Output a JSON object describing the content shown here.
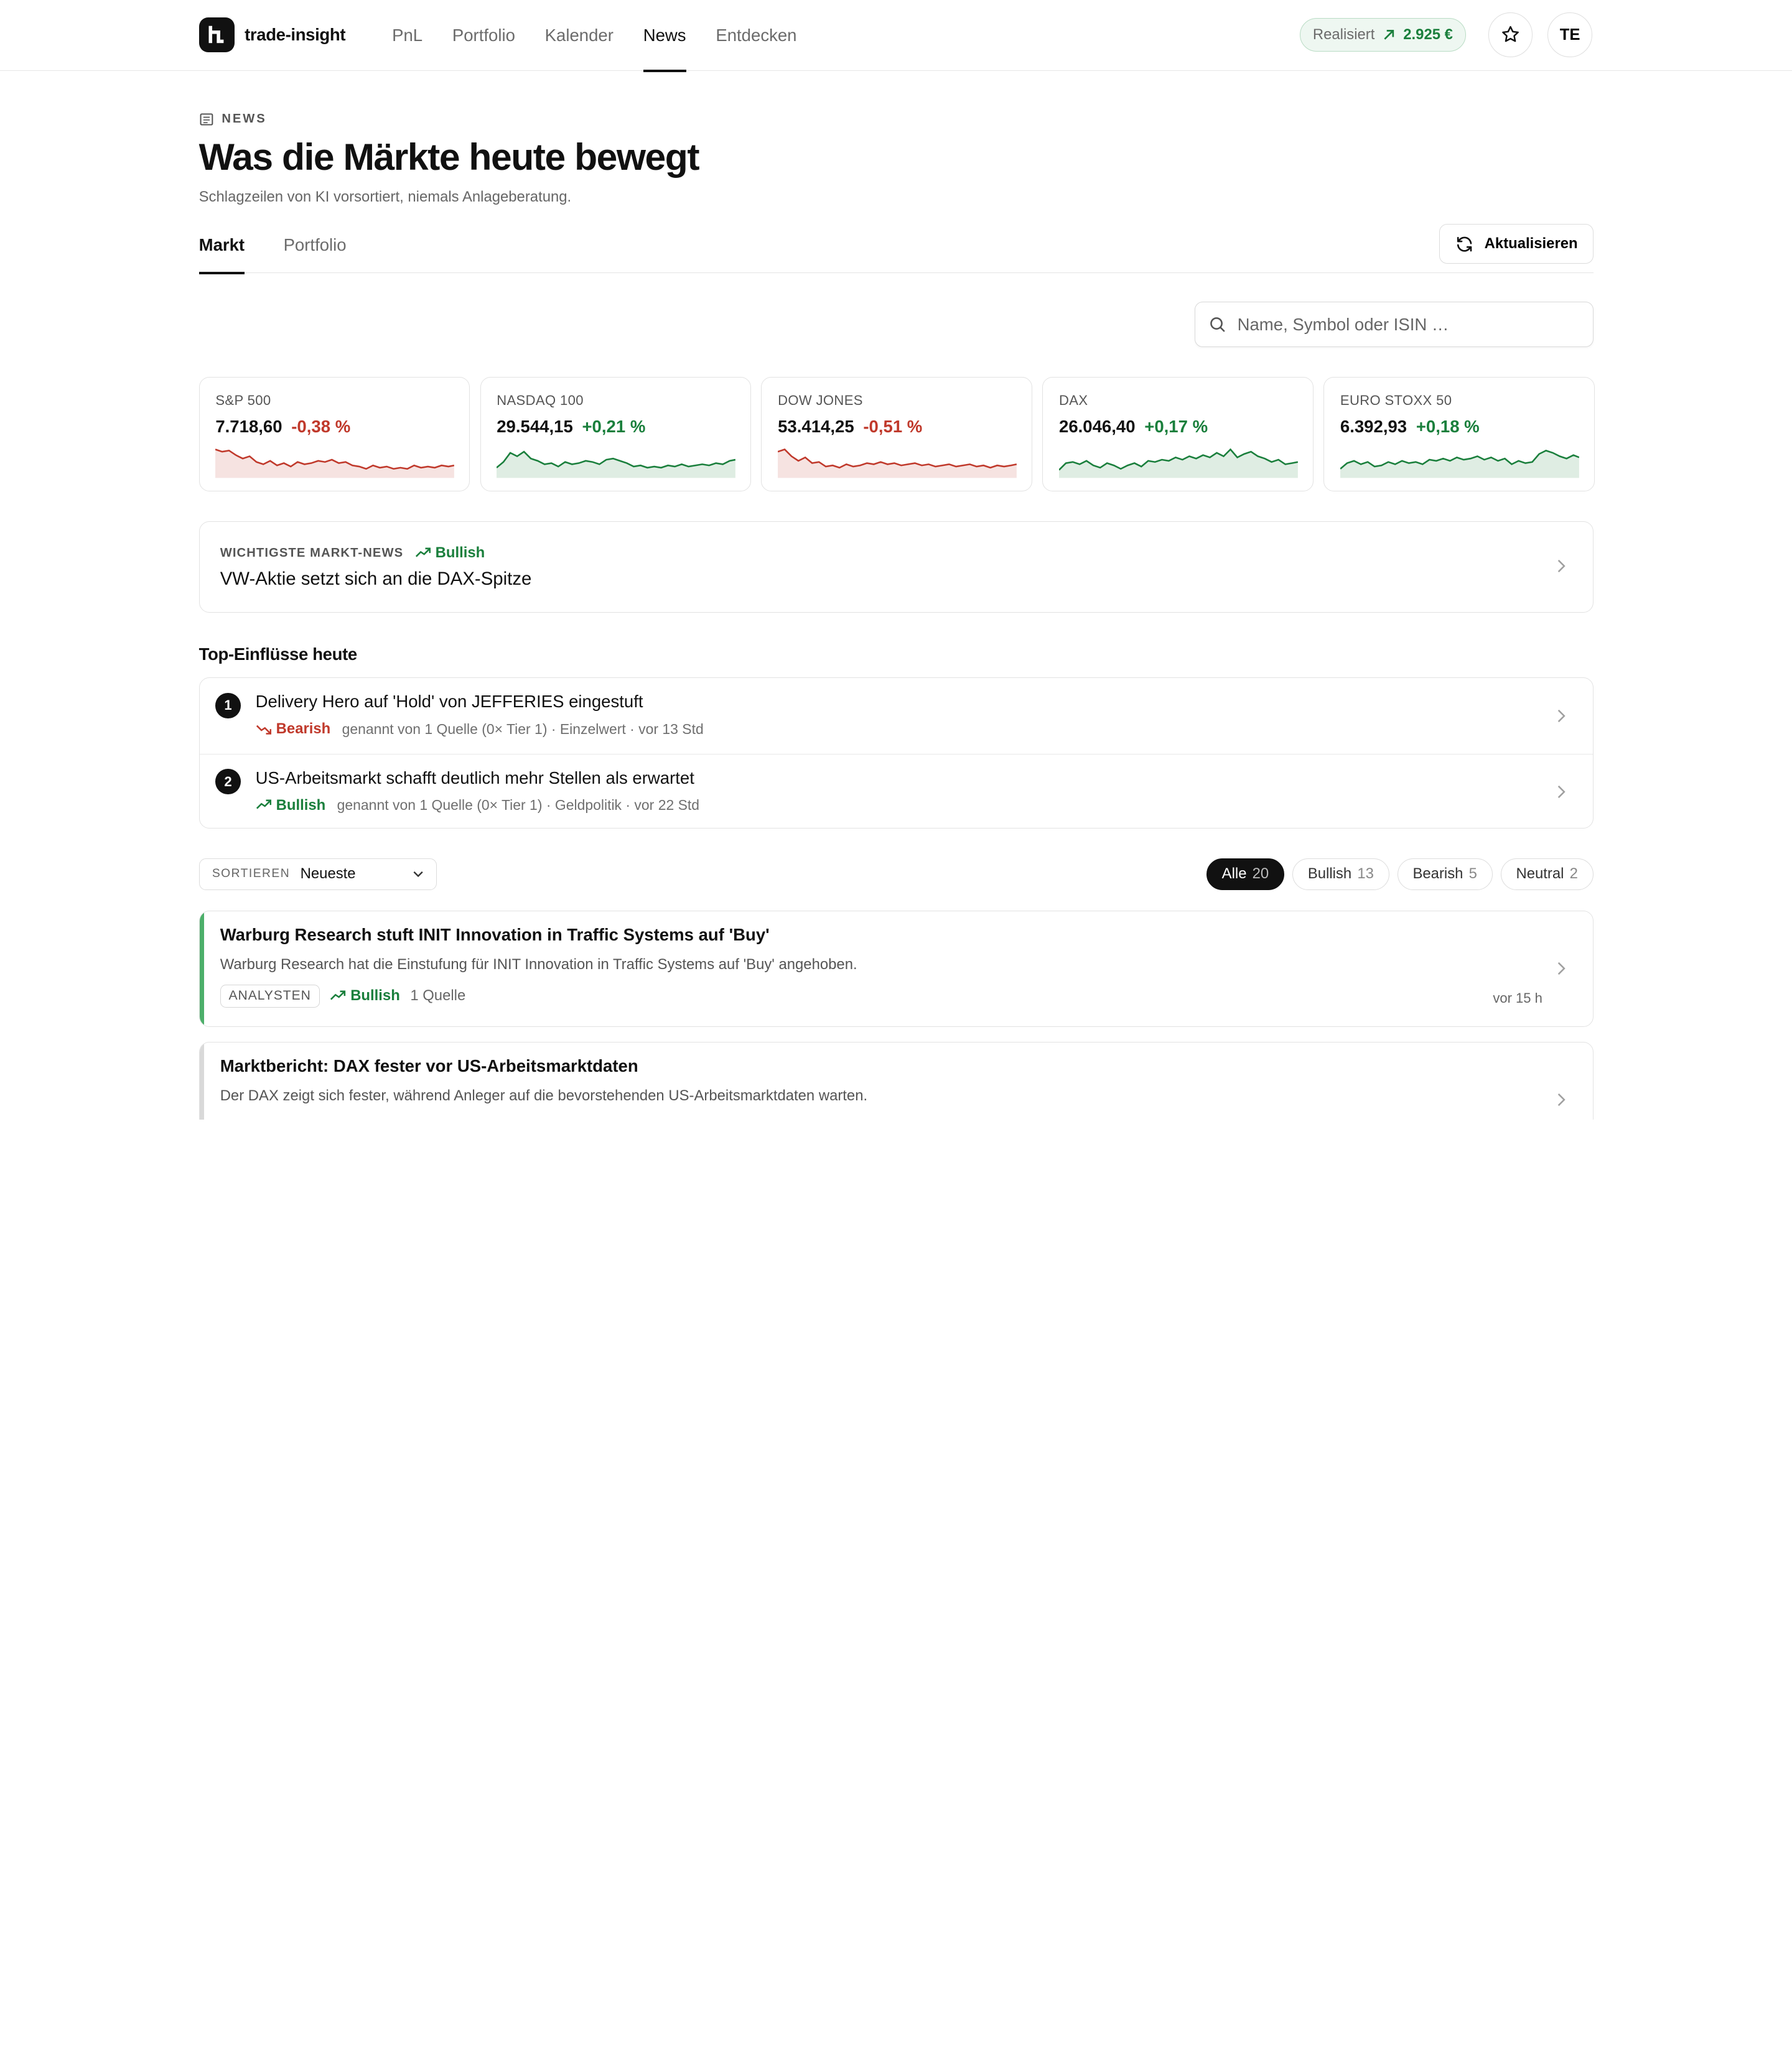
{
  "app": {
    "name": "trade-insight"
  },
  "nav": {
    "items": [
      {
        "label": "PnL"
      },
      {
        "label": "Portfolio"
      },
      {
        "label": "Kalender"
      },
      {
        "label": "News"
      },
      {
        "label": "Entdecken"
      }
    ],
    "active": "News"
  },
  "realized": {
    "label": "Realisiert",
    "value": "2.925 €"
  },
  "user": {
    "initials": "TE"
  },
  "page": {
    "eyebrow": "NEWS",
    "title": "Was die Märkte heute bewegt",
    "subtitle": "Schlagzeilen von KI vorsortiert, niemals Anlageberatung."
  },
  "tabs": [
    {
      "label": "Markt"
    },
    {
      "label": "Portfolio"
    }
  ],
  "refresh_label": "Aktualisieren",
  "search": {
    "placeholder": "Name, Symbol oder ISIN …"
  },
  "indices": [
    {
      "name": "S&P 500",
      "value": "7.718,60",
      "change": "-0,38 %",
      "direction": "down",
      "color": "#c0392b"
    },
    {
      "name": "NASDAQ 100",
      "value": "29.544,15",
      "change": "+0,21 %",
      "direction": "up",
      "color": "#1a7f3c"
    },
    {
      "name": "DOW JONES",
      "value": "53.414,25",
      "change": "-0,51 %",
      "direction": "down",
      "color": "#c0392b"
    },
    {
      "name": "DAX",
      "value": "26.046,40",
      "change": "+0,17 %",
      "direction": "up",
      "color": "#1a7f3c"
    },
    {
      "name": "EURO STOXX 50",
      "value": "6.392,93",
      "change": "+0,18 %",
      "direction": "up",
      "color": "#1a7f3c"
    }
  ],
  "top_news": {
    "eyebrow": "WICHTIGSTE MARKT-NEWS",
    "sentiment": "Bullish",
    "headline": "VW-Aktie setzt sich an die DAX-Spitze"
  },
  "influences": {
    "heading": "Top-Einflüsse heute",
    "items": [
      {
        "rank": "1",
        "title": "Delivery Hero auf 'Hold' von JEFFERIES eingestuft",
        "sentiment": "Bearish",
        "meta": "genannt von 1 Quelle (0× Tier 1) · Einzelwert · vor 13 Std"
      },
      {
        "rank": "2",
        "title": "US-Arbeitsmarkt schafft deutlich mehr Stellen als erwartet",
        "sentiment": "Bullish",
        "meta": "genannt von 1 Quelle (0× Tier 1) · Geldpolitik · vor 22 Std"
      }
    ]
  },
  "sort": {
    "label": "SORTIEREN",
    "value": "Neueste"
  },
  "filters": [
    {
      "label": "Alle",
      "count": "20",
      "active": true
    },
    {
      "label": "Bullish",
      "count": "13"
    },
    {
      "label": "Bearish",
      "count": "5"
    },
    {
      "label": "Neutral",
      "count": "2"
    }
  ],
  "news": [
    {
      "title": "Warburg Research stuft INIT Innovation in Traffic Systems auf 'Buy'",
      "summary": "Warburg Research hat die Einstufung für INIT Innovation in Traffic Systems auf 'Buy' angehoben.",
      "category": "ANALYSTEN",
      "sentiment": "Bullish",
      "sources": "1 Quelle",
      "time": "vor 15 h",
      "accent": "#4caf6a"
    },
    {
      "title": "Marktbericht: DAX fester vor US-Arbeitsmarktdaten",
      "summary": "Der DAX zeigt sich fester, während Anleger auf die bevorstehenden US-Arbeitsmarktdaten warten.",
      "accent": "#d9d9d9"
    }
  ]
}
